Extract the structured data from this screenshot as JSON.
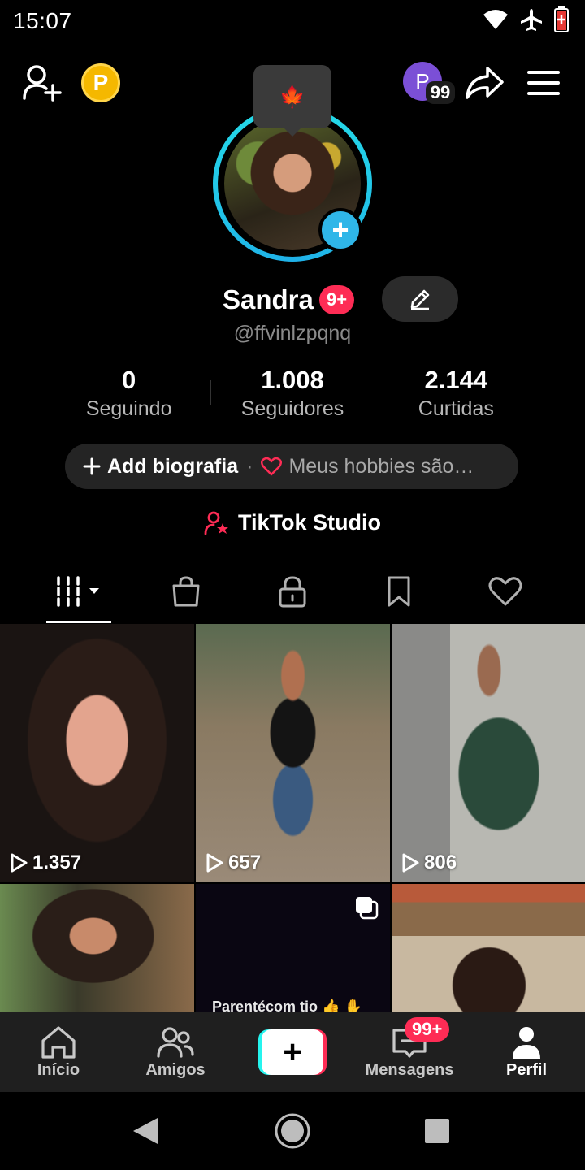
{
  "status_bar": {
    "time": "15:07",
    "icons": [
      "wifi-icon",
      "airplane-icon",
      "battery-low-icon"
    ]
  },
  "top_bar": {
    "add_friend_icon": "person-plus-icon",
    "coin_label": "P",
    "profile_switch_initial": "P",
    "profile_switch_badge": "99",
    "share_icon": "share-arrow-icon",
    "menu_icon": "hamburger-menu-icon"
  },
  "tooltip": {
    "icon": "maple-leaf-icon",
    "glyph": "🍁"
  },
  "profile": {
    "name": "Sandra",
    "name_badge": "9+",
    "handle": "@ffvinlzpqnq",
    "edit_icon": "pencil-icon"
  },
  "stats": [
    {
      "value": "0",
      "label": "Seguindo"
    },
    {
      "value": "1.008",
      "label": "Seguidores"
    },
    {
      "value": "2.144",
      "label": "Curtidas"
    }
  ],
  "bio": {
    "add_label": "Add biografia",
    "separator": "·",
    "hobby_text": "Meus hobbies são…"
  },
  "studio": {
    "label": "TikTok Studio"
  },
  "tabs": [
    {
      "name": "videos",
      "icon": "grid-bars-icon",
      "active": true
    },
    {
      "name": "shop",
      "icon": "shopping-bag-icon"
    },
    {
      "name": "private",
      "icon": "lock-icon"
    },
    {
      "name": "saved",
      "icon": "bookmark-icon"
    },
    {
      "name": "liked",
      "icon": "heart-icon"
    }
  ],
  "videos": [
    {
      "views": "1.357"
    },
    {
      "views": "657"
    },
    {
      "views": "806"
    },
    {
      "views": ""
    },
    {
      "views": "",
      "caption": "Parentécom tio 👍 ✋"
    },
    {
      "views": ""
    }
  ],
  "bottom_nav": {
    "home": "Início",
    "friends": "Amigos",
    "create": "+",
    "messages": "Mensagens",
    "messages_badge": "99+",
    "profile": "Perfil"
  },
  "colors": {
    "accent_red": "#fe2c55",
    "accent_cyan": "#25f4ee",
    "ring_blue": "#2fb6e8",
    "coin_gold": "#f5b800",
    "switch_purple": "#7b4fd6"
  }
}
